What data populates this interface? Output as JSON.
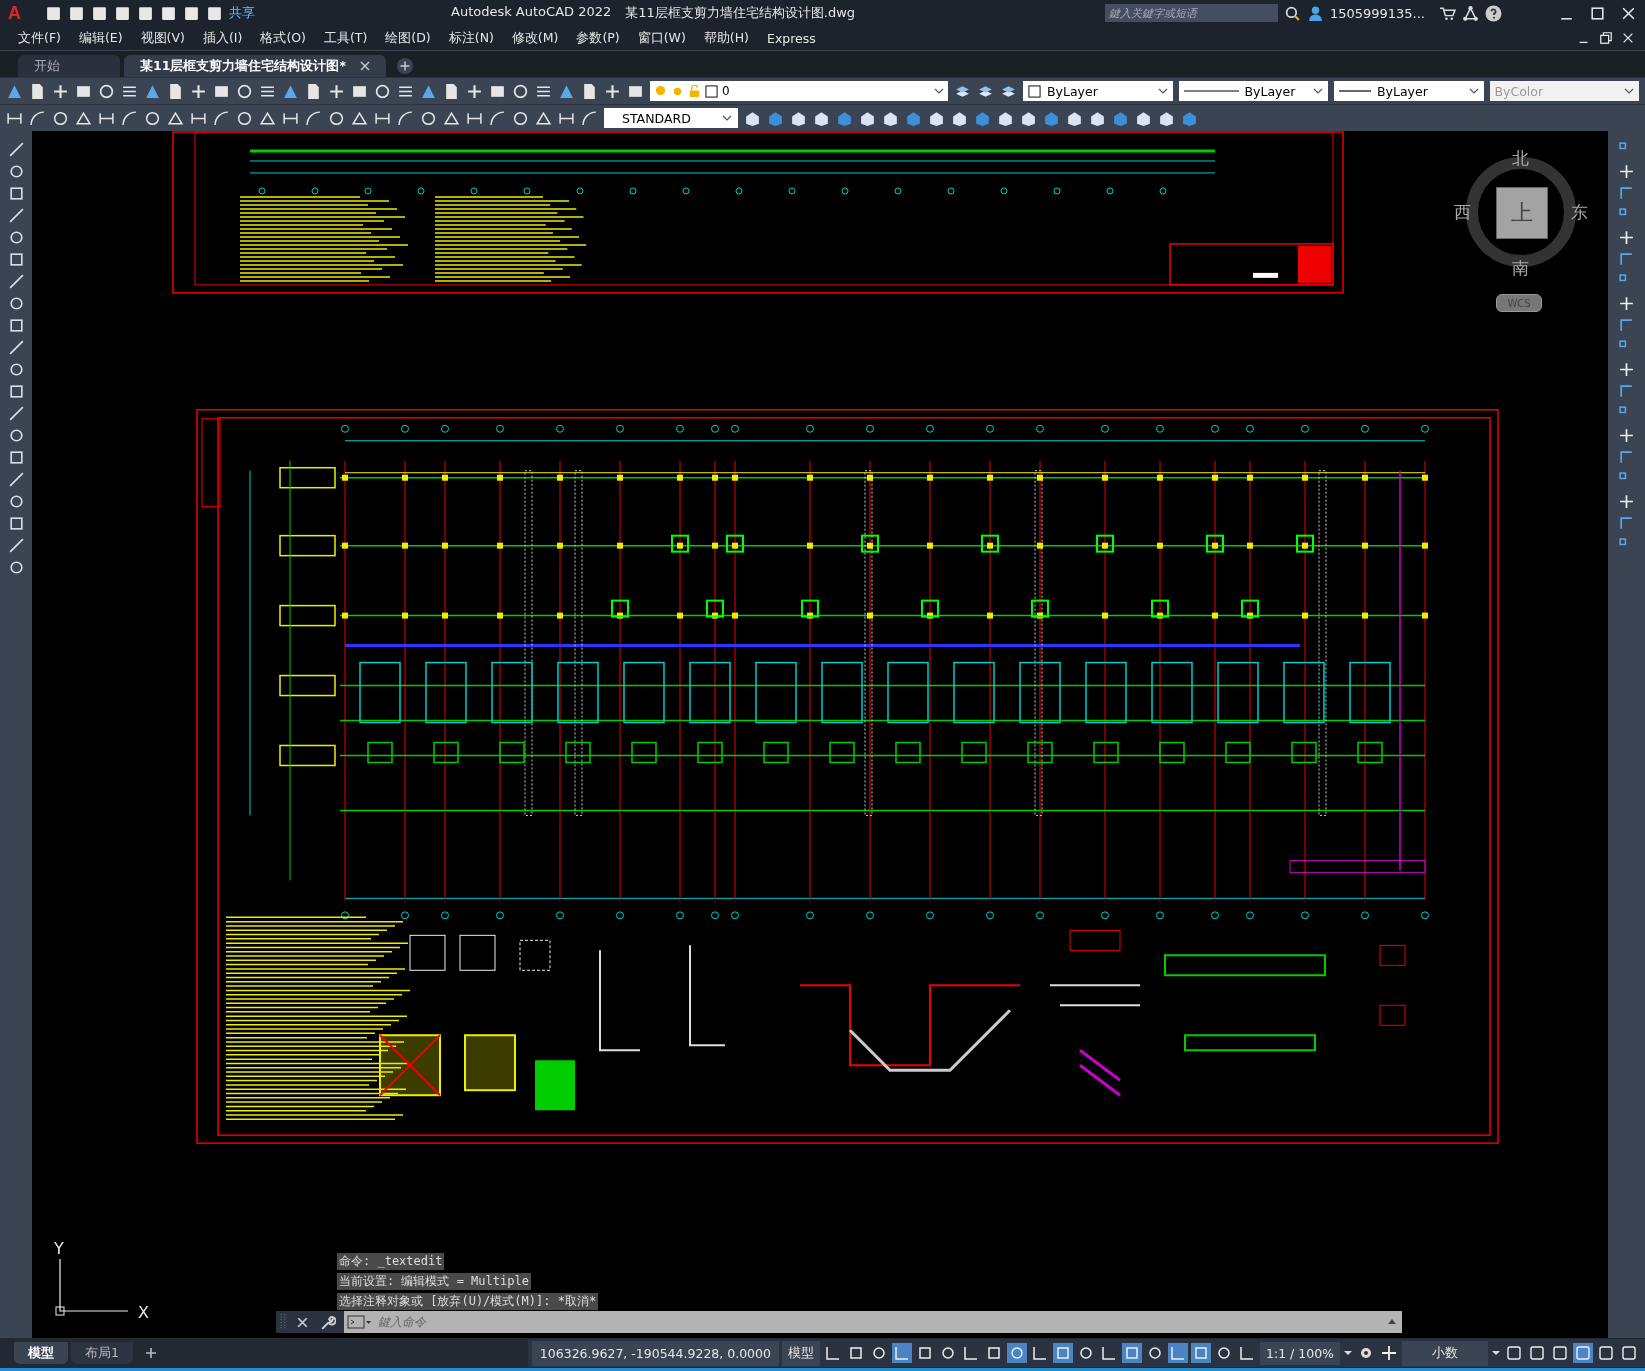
{
  "title_bar": {
    "logo": "A",
    "share": "共享",
    "app_title": "Autodesk AutoCAD 2022",
    "file_name": "某11层框支剪力墙住宅结构设计图.dwg",
    "search": {
      "placeholder": "鍵入关鍵字或短语"
    },
    "user": "1505999135..."
  },
  "menu": [
    "文件(F)",
    "编辑(E)",
    "视图(V)",
    "插入(I)",
    "格式(O)",
    "工具(T)",
    "绘图(D)",
    "标注(N)",
    "修改(M)",
    "参数(P)",
    "窗口(W)",
    "帮助(H)",
    "Express"
  ],
  "tabs": [
    {
      "label": "开始",
      "selected": false
    },
    {
      "label": "某11层框支剪力墙住宅结构设计图*",
      "selected": true
    }
  ],
  "toolbar": {
    "layer": "0",
    "dim_style": "STANDARD",
    "properties": [
      {
        "value": "ByLayer",
        "kind": "color",
        "disabled": false
      },
      {
        "value": "ByLayer",
        "kind": "linetype",
        "disabled": false
      },
      {
        "value": "ByLayer",
        "kind": "lineweight",
        "disabled": false
      },
      {
        "value": "ByColor",
        "kind": "plot",
        "disabled": true
      }
    ]
  },
  "viewcube": {
    "north": "北",
    "south": "南",
    "west": "西",
    "east": "东",
    "top": "上",
    "coordinate_system": "WCS"
  },
  "ucs": {
    "y": "Y",
    "x": "X"
  },
  "command_history": [
    "命令: _textedit",
    "当前设置: 编辑模式 = Multiple",
    "选择注释对象或 [放弃(U)/模式(M)]: *取消*"
  ],
  "command_line": {
    "placeholder": "鍵入命令"
  },
  "layout_tabs": [
    {
      "label": "模型",
      "selected": true
    },
    {
      "label": "布局1",
      "selected": false
    }
  ],
  "status_bar": {
    "coordinates": "106326.9627, -190544.9228, 0.0000",
    "space": "模型",
    "toggles": [
      {
        "on": false
      },
      {
        "on": false
      },
      {
        "on": false
      },
      {
        "on": true
      },
      {
        "on": false
      },
      {
        "on": false
      },
      {
        "on": false
      },
      {
        "on": false
      },
      {
        "on": true
      },
      {
        "on": false
      },
      {
        "on": true
      },
      {
        "on": false
      },
      {
        "on": false
      },
      {
        "on": true
      },
      {
        "on": false
      },
      {
        "on": true
      },
      {
        "on": true
      },
      {
        "on": false
      },
      {
        "on": false
      }
    ],
    "scale": "1:1 / 100%",
    "units": "小数"
  }
}
